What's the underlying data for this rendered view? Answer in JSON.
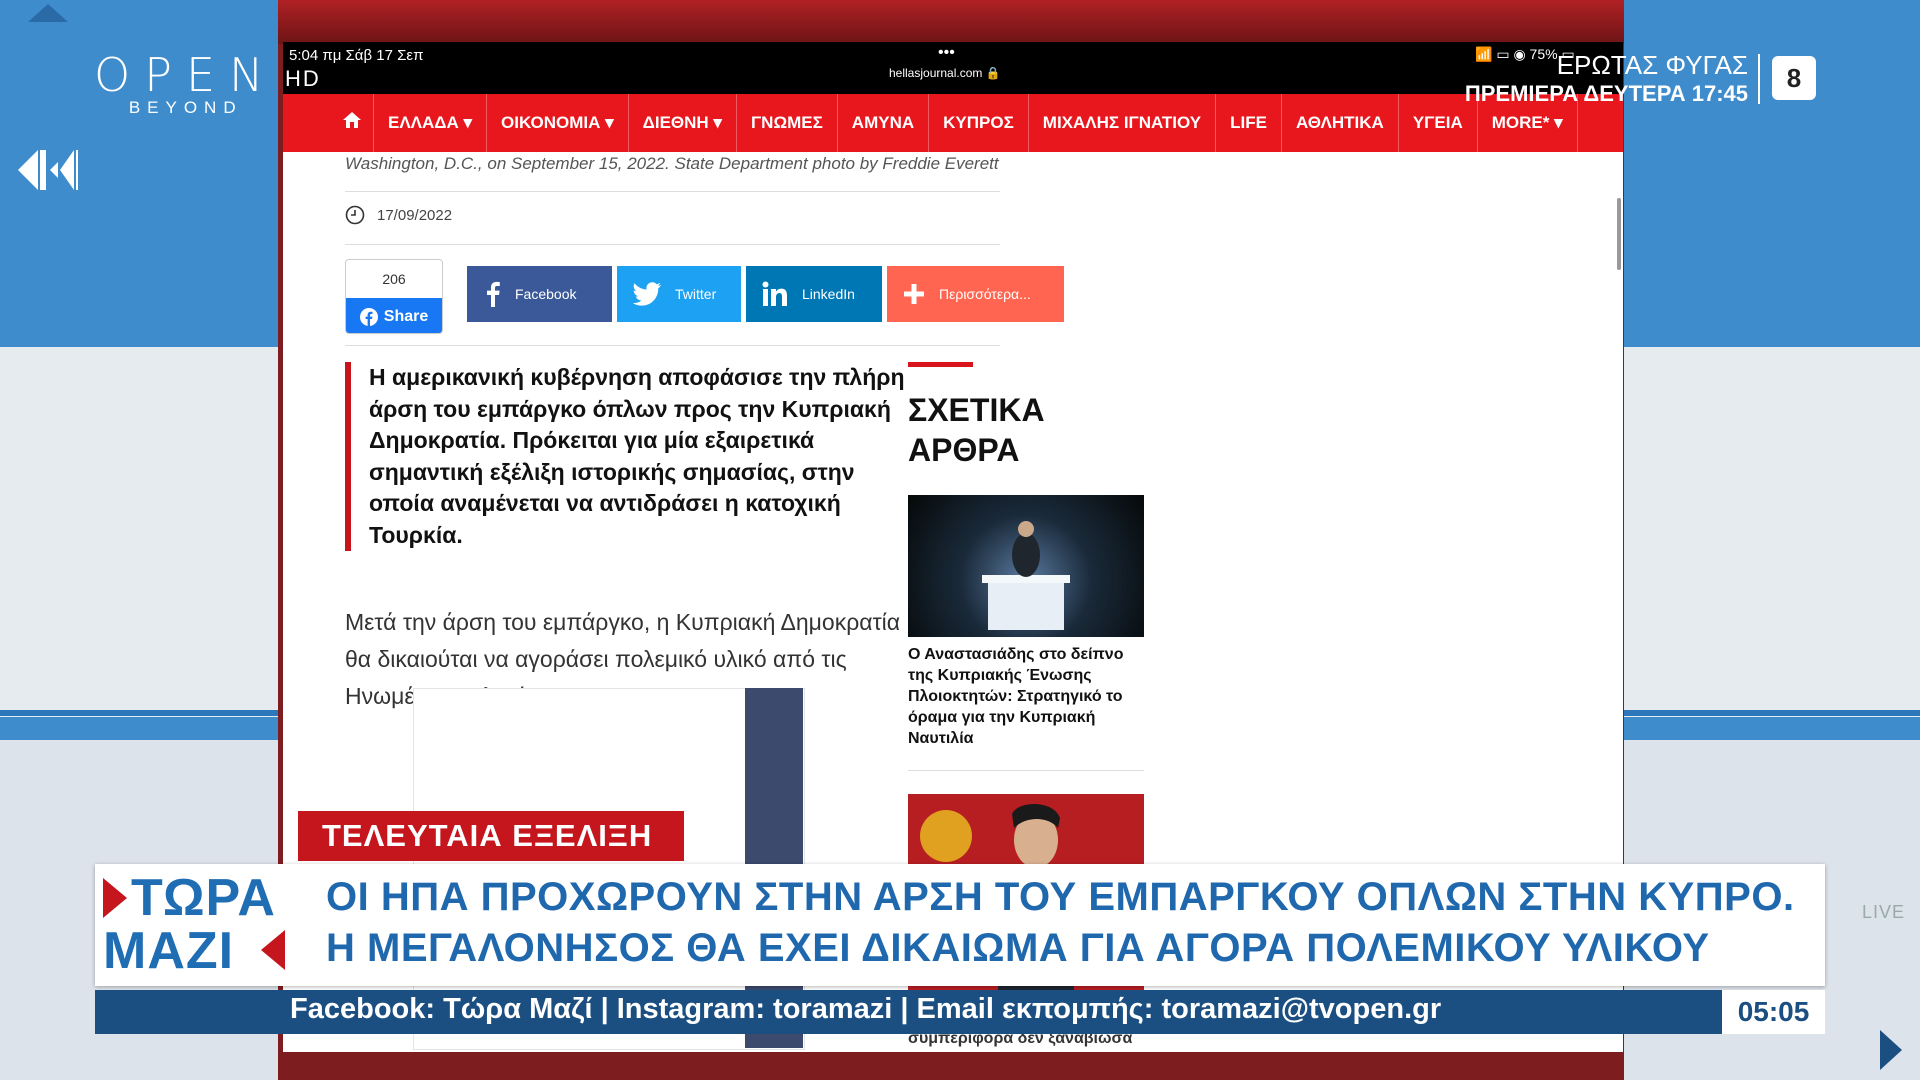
{
  "channel": {
    "logo_big": "OPEN",
    "logo_small": "BEYOND",
    "quality": "HD"
  },
  "promo": {
    "line1": "ΕΡΩΤΑΣ ΦΥΓΑΣ",
    "line2": "ΠΡΕΜΙΕΡΑ ΔΕΥΤΕΡΑ 17:45",
    "rating": "8"
  },
  "tablet": {
    "status_time": "5:04 πμ   Σάβ 17 Σεπ",
    "status_dots": "•••",
    "url": "hellasjournal.com 🔒",
    "status_right": "📶 ▭ ◉ 75% ▭"
  },
  "site_nav": {
    "home_icon": "home-icon",
    "items": [
      "ΕΛΛΑΔΑ ▾",
      "ΟΙΚΟΝΟΜΙΑ ▾",
      "ΔΙΕΘΝΗ ▾",
      "ΓΝΩΜΕΣ",
      "ΑΜΥΝΑ",
      "ΚΥΠΡΟΣ",
      "ΜΙΧΑΛΗΣ ΙΓΝΑΤΙΟΥ",
      "LIFE",
      "ΑΘΛΗΤΙΚΑ",
      "ΥΓΕΙΑ",
      "MORE* ▾"
    ]
  },
  "article": {
    "photo_caption": "Washington, D.C., on September 15, 2022. State Department photo by Freddie Everett",
    "date": "17/09/2022",
    "fb_count": "206",
    "fb_share": "Share",
    "share_buttons": [
      {
        "label": "Facebook",
        "color": "#3b5998"
      },
      {
        "label": "Twitter",
        "color": "#1da1f2"
      },
      {
        "label": "LinkedIn",
        "color": "#0077b5"
      },
      {
        "label": "Περισσότερα...",
        "color": "#ff6550"
      }
    ],
    "lead": "Η αμερικανική κυβέρνηση αποφάσισε την πλήρη άρση του εμπάργκο όπλων προς την Κυπριακή Δημοκρατία. Πρόκειται για μία εξαιρετικά σημαντική εξέλιξη ιστορικής σημασίας, στην οποία αναμένεται να αντιδράσει η κατοχική Τουρκία.",
    "body": "Μετά την άρση του εμπάργκο, η Κυπριακή Δημοκρατία θα δικαιούται να αγοράσει πολεμικό υλικό από τις Ηνωμένες Πολιτείες."
  },
  "related": {
    "title_line1": "ΣΧΕΤΙΚΑ",
    "title_line2": "ΑΡΘΡΑ",
    "item1_caption": "Ο Αναστασιάδης στο δείπνο της Κυπριακής Ένωσης Πλοιοκτητών: Στρατηγικό το όραμα για την Κυπριακή Ναυτιλία",
    "item2_caption": "βουλευτή του ΑΚΕΛ εναντίον ... συμπεριφορά δεν ξαναβίωσα"
  },
  "lower_third": {
    "breaking": "ΤΕΛΕΥΤΑΙΑ ΕΞΕΛΙΞΗ",
    "show_line1": "ΤΩΡΑ",
    "show_line2": "ΜΑΖΙ",
    "headline_line1": "ΟΙ ΗΠΑ ΠΡΟΧΩΡΟΥΝ ΣΤΗΝ ΑΡΣΗ ΤΟΥ ΕΜΠΑΡΓΚΟΥ ΟΠΛΩΝ ΣΤΗΝ ΚΥΠΡΟ.",
    "headline_line2": "Η ΜΕΓΑΛΟΝΗΣΟΣ ΘΑ ΕΧΕΙ ΔΙΚΑΙΩΜΑ ΓΙΑ ΑΓΟΡΑ ΠΟΛΕΜΙΚΟΥ ΥΛΙΚΟΥ",
    "ticker": "Facebook: Τώρα Μαζί | Instagram: toramazi | Email εκπομπής: toramazi@tvopen.gr",
    "clock": "05:05",
    "live": "LIVE"
  },
  "colors": {
    "brand_blue": "#1f6db3",
    "site_red": "#e8171d",
    "breaking_red": "#c4161c",
    "ticker_navy": "#1b4f82"
  }
}
